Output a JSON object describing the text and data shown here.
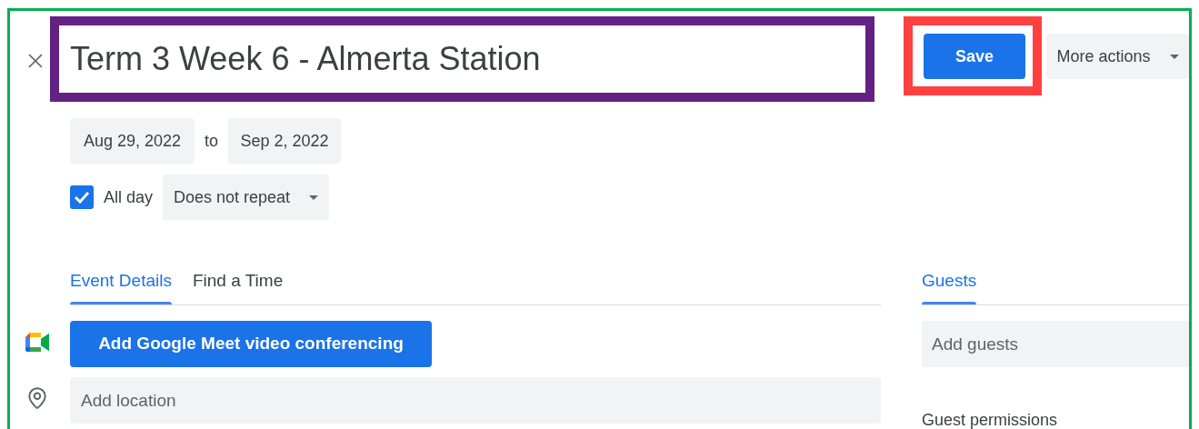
{
  "title": {
    "value": "Term 3 Week 6 - Almerta Station"
  },
  "actions": {
    "save": "Save",
    "more": "More actions"
  },
  "dates": {
    "start": "Aug 29, 2022",
    "separator": "to",
    "end": "Sep 2, 2022"
  },
  "all_day": {
    "label": "All day",
    "checked": true
  },
  "repeat": {
    "value": "Does not repeat"
  },
  "tabs": [
    {
      "label": "Event Details",
      "selected": true
    },
    {
      "label": "Find a Time",
      "selected": false
    }
  ],
  "meet_button": "Add Google Meet video conferencing",
  "location": {
    "placeholder": "Add location"
  },
  "guests": {
    "tab": {
      "label": "Guests",
      "selected": true
    },
    "field": {
      "placeholder": "Add guests"
    },
    "permissions_heading": "Guest permissions"
  }
}
